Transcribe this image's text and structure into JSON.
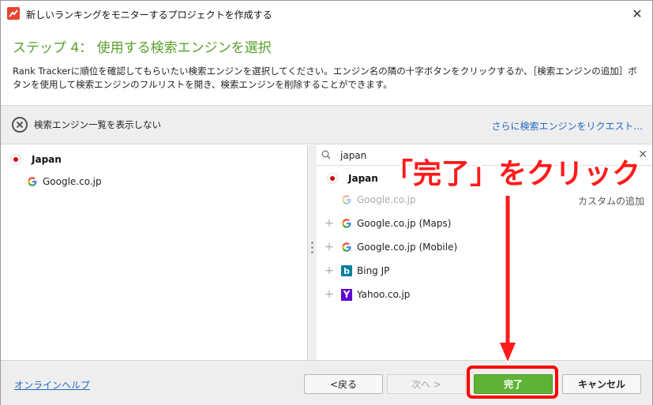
{
  "window": {
    "title": "新しいランキングをモニターするプロジェクトを作成する"
  },
  "header": {
    "step_title": "ステップ 4： 使用する検索エンジンを選択",
    "description": "Rank Trackerに順位を確認してもらいたい検索エンジンを選択してください。エンジン名の隣の十字ボタンをクリックするか、［検索エンジンの追加］ボタンを使用して検索エンジンのフルリストを開き、検索エンジンを削除することができます。"
  },
  "toolbar": {
    "hide_list_label": "検索エンジン一覧を表示しない",
    "request_link": "さらに検索エンジンをリクエスト..."
  },
  "left_pane": {
    "country": "Japan",
    "engines": [
      "Google.co.jp"
    ]
  },
  "right_pane": {
    "search_value": "japan",
    "country": "Japan",
    "custom_add": "カスタムの追加",
    "selected_engine": "Google.co.jp",
    "available_engines": [
      {
        "label": "Google.co.jp (Maps)",
        "icon": "google-icon"
      },
      {
        "label": "Google.co.jp (Mobile)",
        "icon": "google-icon"
      },
      {
        "label": "Bing JP",
        "icon": "bing-icon"
      },
      {
        "label": "Yahoo.co.jp",
        "icon": "yahoo-icon"
      }
    ]
  },
  "footer": {
    "help_link": "オンラインヘルプ",
    "back_label": "<戻る",
    "next_label": "次へ >",
    "finish_label": "完了",
    "cancel_label": "キャンセル"
  },
  "annotation": {
    "text": "「完了」をクリック",
    "color": "#ff1a1a"
  },
  "colors": {
    "accent_green": "#5aa02c",
    "finish_button": "#5fb236",
    "link_blue": "#2468c4"
  }
}
